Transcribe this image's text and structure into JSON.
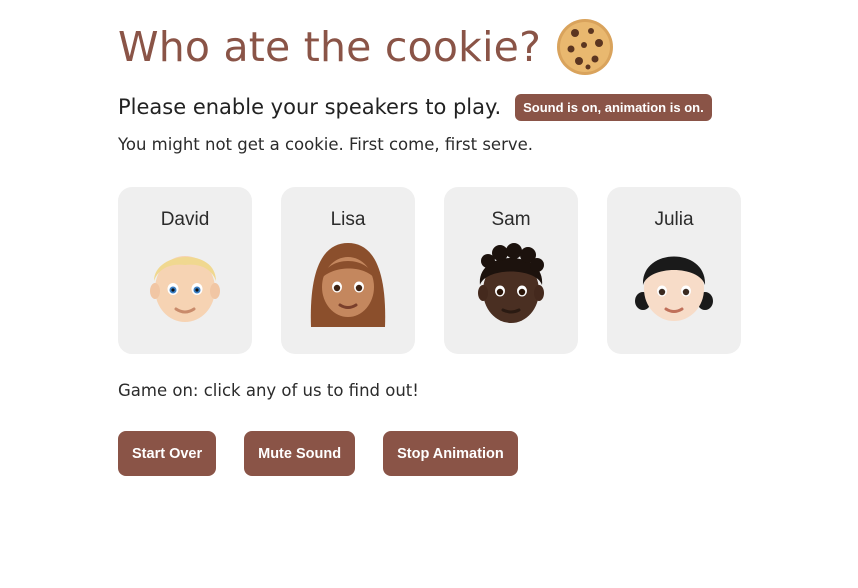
{
  "header": {
    "title": "Who ate the cookie?",
    "title_icon": "cookie-icon"
  },
  "intro": {
    "speakers_text": "Please enable your speakers to play.",
    "status_badge": "Sound is on, animation is on.",
    "note": "You might not get a cookie. First come, first serve."
  },
  "characters": [
    {
      "name": "David",
      "icon": "blond-man-icon"
    },
    {
      "name": "Lisa",
      "icon": "woman-medium-skin-icon"
    },
    {
      "name": "Sam",
      "icon": "man-dark-skin-icon"
    },
    {
      "name": "Julia",
      "icon": "girl-pigtails-icon"
    }
  ],
  "game": {
    "status": "Game on: click any of us to find out!"
  },
  "controls": {
    "start_over": "Start Over",
    "mute_sound": "Mute Sound",
    "stop_animation": "Stop Animation"
  },
  "colors": {
    "accent": "#8a5447",
    "card_bg": "#efefef"
  }
}
